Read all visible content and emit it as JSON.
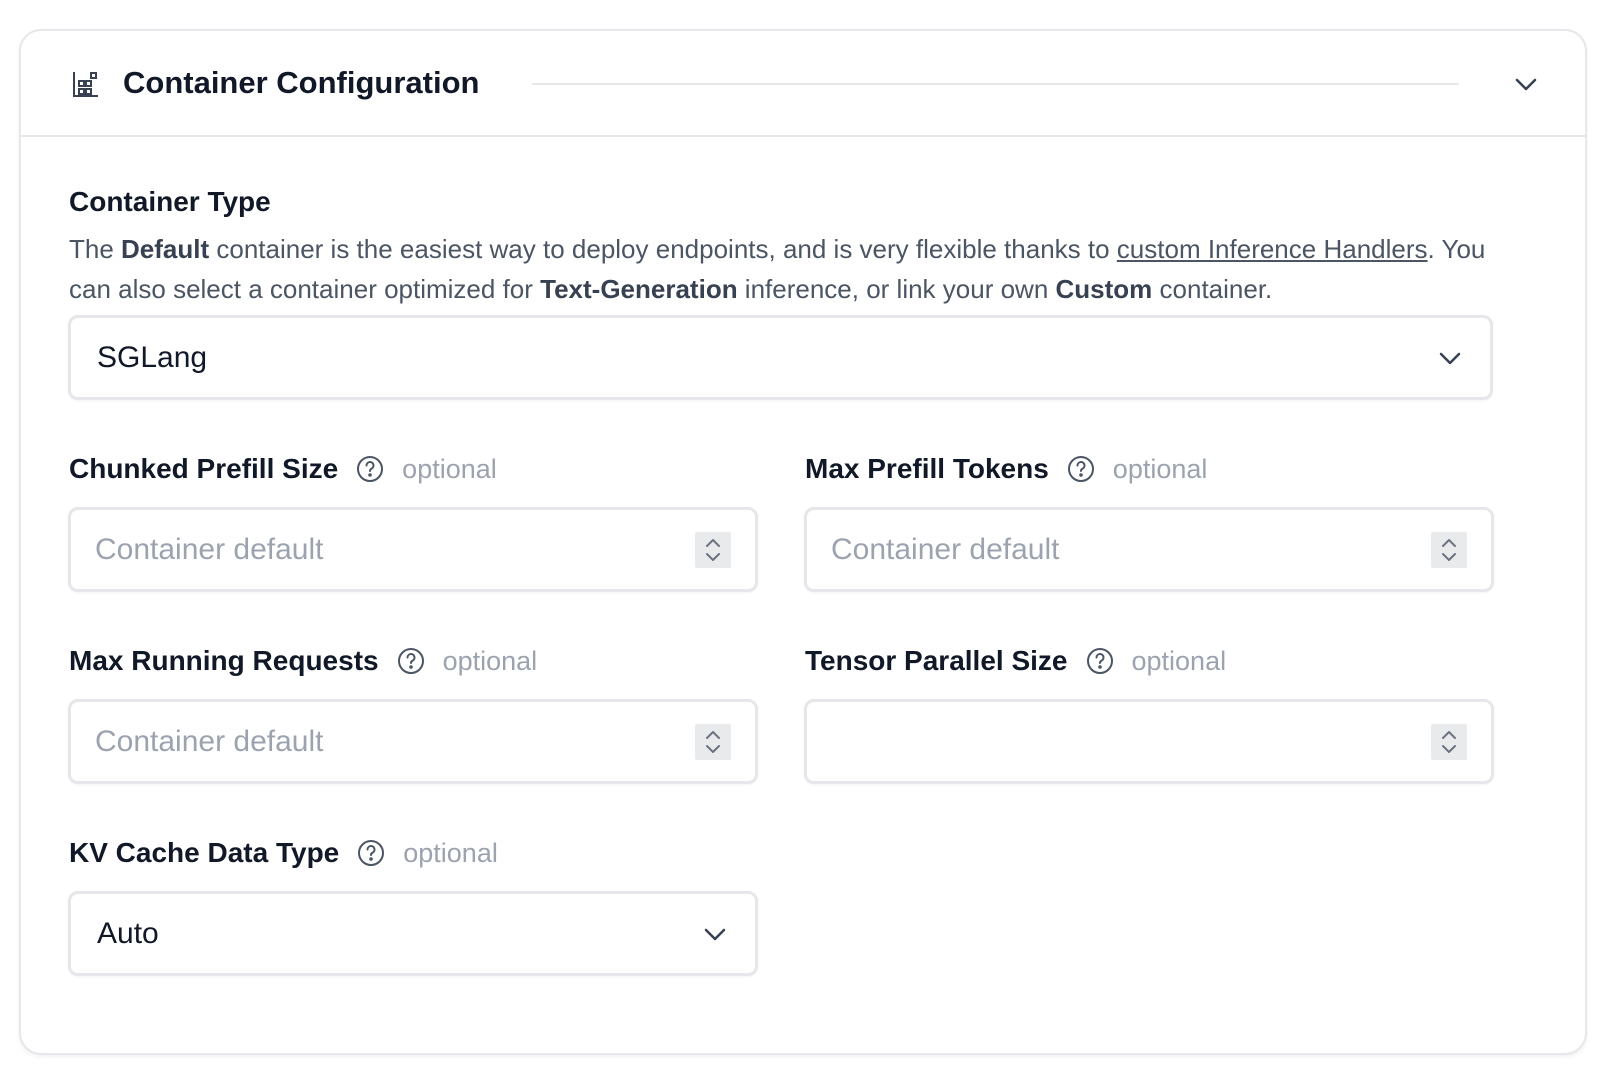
{
  "header": {
    "icon": "container-grid-icon",
    "title": "Container Configuration",
    "collapse_icon": "chevron-down-icon"
  },
  "container_type": {
    "title": "Container Type",
    "description": {
      "part1": "The ",
      "bold_default": "Default",
      "part2": " container is the easiest way to deploy endpoints, and is very flexible thanks to ",
      "link_text": "custom Inference Handlers",
      "part3": ". You can also select a container optimized for ",
      "bold_textgen": "Text-Generation",
      "part4": " inference, or link your own ",
      "bold_custom": "Custom",
      "part5": " container."
    },
    "selected": "SGLang"
  },
  "fields": {
    "chunked_prefill_size": {
      "label": "Chunked Prefill Size",
      "optional": "optional",
      "placeholder": "Container default",
      "value": ""
    },
    "max_prefill_tokens": {
      "label": "Max Prefill Tokens",
      "optional": "optional",
      "placeholder": "Container default",
      "value": ""
    },
    "max_running_requests": {
      "label": "Max Running Requests",
      "optional": "optional",
      "placeholder": "Container default",
      "value": ""
    },
    "tensor_parallel_size": {
      "label": "Tensor Parallel Size",
      "optional": "optional",
      "placeholder": "",
      "value": ""
    },
    "kv_cache_data_type": {
      "label": "KV Cache Data Type",
      "optional": "optional",
      "selected": "Auto"
    }
  },
  "colors": {
    "border": "#e5e7eb",
    "muted_text": "#9ca3af",
    "body_text": "#4b5563",
    "heading_text": "#111827",
    "stepper_bg": "#e9eaec"
  }
}
